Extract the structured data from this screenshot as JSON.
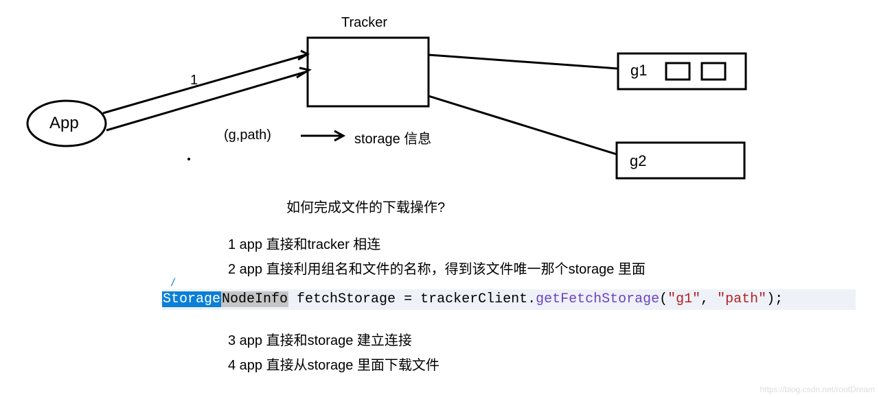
{
  "nodes": {
    "app": "App",
    "tracker_title": "Tracker",
    "g1": "g1",
    "g2": "g2"
  },
  "edges": {
    "edge1_label": "1",
    "gpath_label": "(g,path)",
    "storage_info": "storage 信息"
  },
  "question": "如何完成文件的下载操作?",
  "steps": {
    "s1": "1 app 直接和tracker 相连",
    "s2": "2 app 直接利用组名和文件的名称，得到该文件唯一那个storage 里面",
    "s3": "3 app 直接和storage 建立连接",
    "s4": "4 app 直接从storage 里面下载文件"
  },
  "code": {
    "t_storage": "Storage",
    "t_nodeinfo": "NodeInfo",
    "var": " fetchStorage ",
    "eq": "= trackerClient.",
    "method": "getFetchStorage",
    "open": "(",
    "arg1": "\"g1\"",
    "comma": ", ",
    "arg2": "\"path\"",
    "close": ");"
  },
  "watermark": "https://blog.csdn.net/rootDream"
}
